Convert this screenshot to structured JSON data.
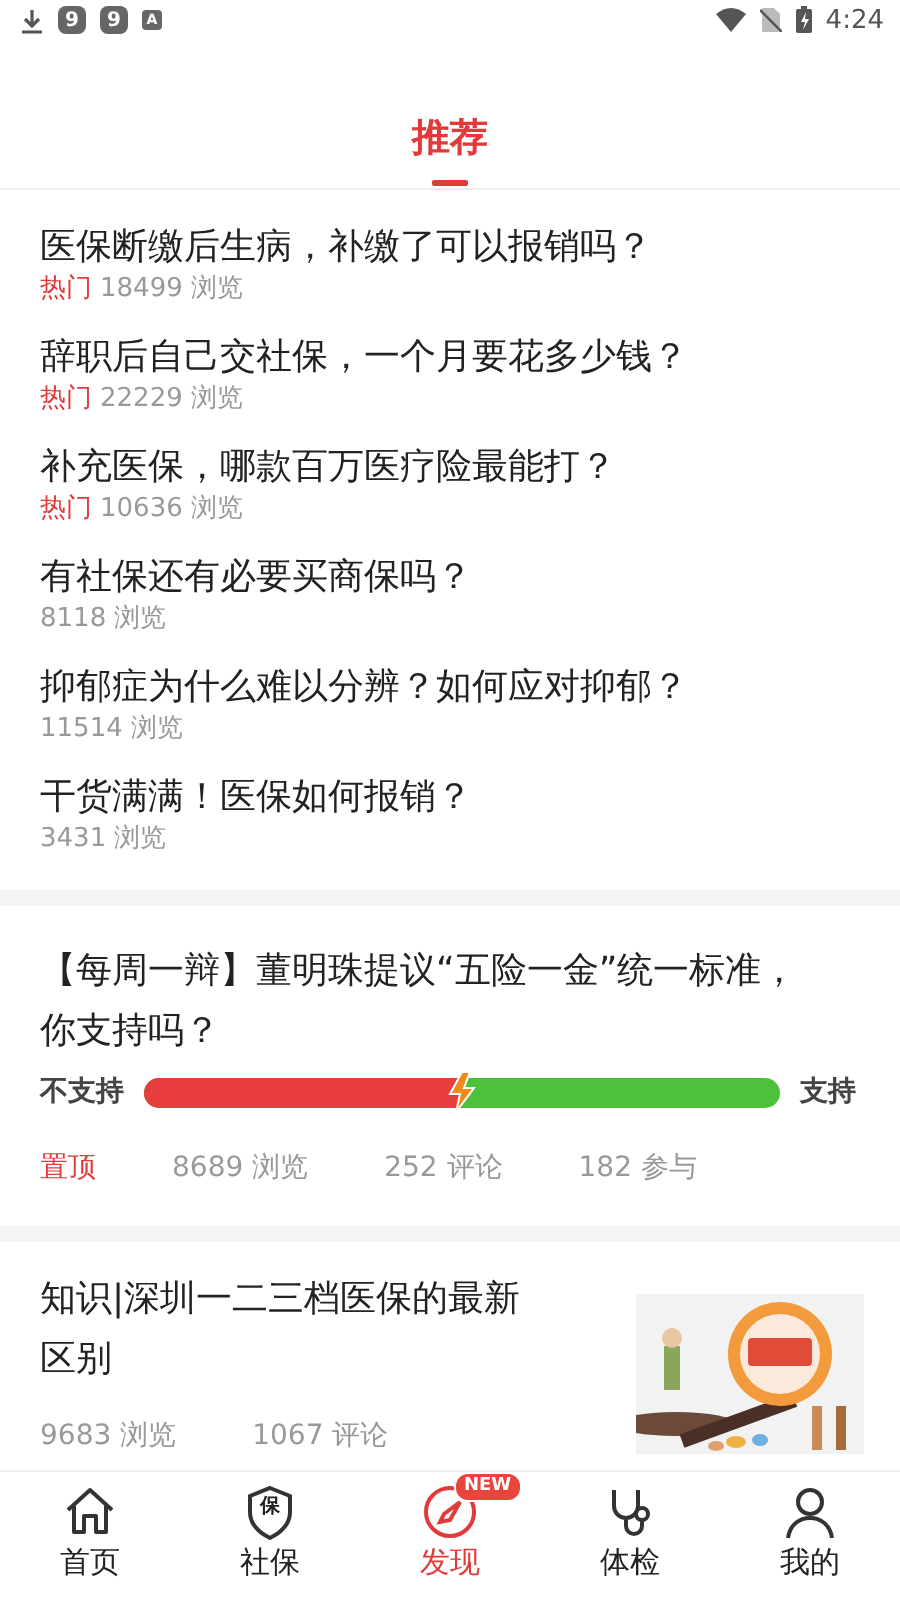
{
  "status_bar": {
    "notifications": [
      "9",
      "9",
      "A"
    ],
    "time": "4:24"
  },
  "tabs": [
    {
      "label": "推荐",
      "selected": true
    }
  ],
  "hot_list": [
    {
      "title": "医保断缴后生病，补缴了可以报销吗？",
      "tag": "热门",
      "views": "18499 浏览"
    },
    {
      "title": "辞职后自己交社保，一个月要花多少钱？",
      "tag": "热门",
      "views": "22229 浏览"
    },
    {
      "title": "补充医保，哪款百万医疗险最能打？",
      "tag": "热门",
      "views": "10636 浏览"
    },
    {
      "title": "有社保还有必要买商保吗？",
      "views": "8118 浏览"
    },
    {
      "title": "抑郁症为什么难以分辨？如何应对抑郁？",
      "views": "11514 浏览"
    },
    {
      "title": "干货满满！医保如何报销？",
      "views": "3431 浏览"
    }
  ],
  "debate": {
    "title": "【每周一辩】董明珠提议“五险一金”统一标准，你支持吗？",
    "oppose_label": "不支持",
    "support_label": "支持",
    "level": 0.5,
    "pinned": "置顶",
    "views": "8689 浏览",
    "comments": "252 评论",
    "participants": "182 参与"
  },
  "article": {
    "title": "知识|深圳一二三档医保的最新区别",
    "views": "9683 浏览",
    "comments": "1067 评论"
  },
  "nav": [
    {
      "label": "首页",
      "selected": false
    },
    {
      "label": "社保",
      "icon_text": "保",
      "selected": false
    },
    {
      "label": "发现",
      "badge": "NEW",
      "selected": true
    },
    {
      "label": "体检",
      "selected": false
    },
    {
      "label": "我的",
      "selected": false
    }
  ]
}
